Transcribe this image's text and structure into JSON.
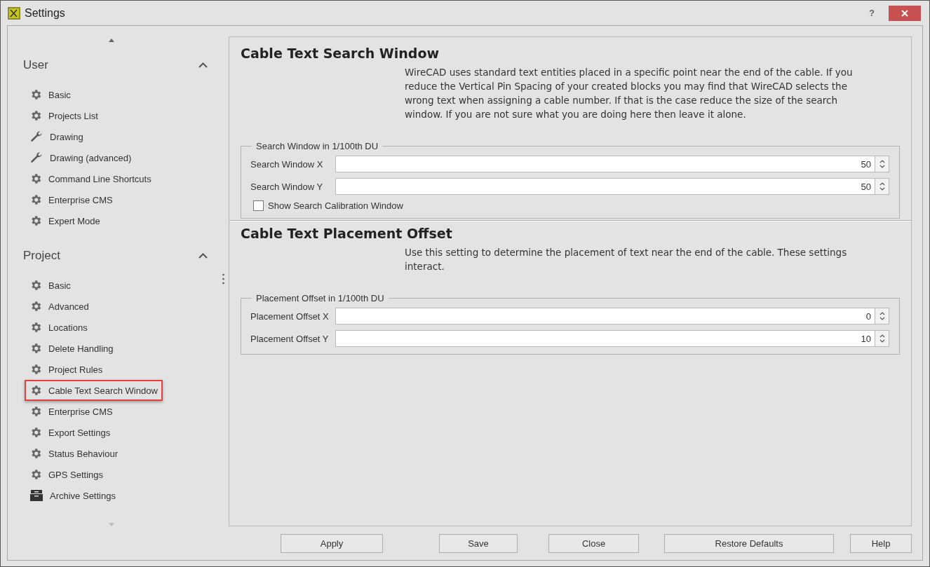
{
  "window": {
    "title": "Settings",
    "help_button": "?"
  },
  "sidebar": {
    "groups": [
      {
        "title": "User",
        "expanded": true,
        "items": [
          {
            "label": "Basic",
            "kind": "gear",
            "selected": false
          },
          {
            "label": "Projects List",
            "kind": "gear",
            "selected": false
          },
          {
            "label": "Drawing",
            "kind": "wrench",
            "selected": false
          },
          {
            "label": "Drawing (advanced)",
            "kind": "wrench",
            "selected": false
          },
          {
            "label": "Command Line Shortcuts",
            "kind": "gear",
            "selected": false
          },
          {
            "label": "Enterprise CMS",
            "kind": "gear",
            "selected": false
          },
          {
            "label": "Expert Mode",
            "kind": "gear",
            "selected": false
          }
        ]
      },
      {
        "title": "Project",
        "expanded": true,
        "items": [
          {
            "label": "Basic",
            "kind": "gear",
            "selected": false
          },
          {
            "label": "Advanced",
            "kind": "gear",
            "selected": false
          },
          {
            "label": "Locations",
            "kind": "gear",
            "selected": false
          },
          {
            "label": "Delete Handling",
            "kind": "gear",
            "selected": false
          },
          {
            "label": "Project Rules",
            "kind": "gear",
            "selected": false
          },
          {
            "label": "Cable Text Search Window",
            "kind": "gear",
            "selected": true
          },
          {
            "label": "Enterprise CMS",
            "kind": "gear",
            "selected": false
          },
          {
            "label": "Export Settings",
            "kind": "gear",
            "selected": false
          },
          {
            "label": "Status Behaviour",
            "kind": "gear",
            "selected": false
          },
          {
            "label": "GPS Settings",
            "kind": "gear",
            "selected": false
          },
          {
            "label": "Archive Settings",
            "kind": "archive",
            "selected": false
          }
        ]
      }
    ]
  },
  "sections": [
    {
      "heading": "Cable Text Search Window",
      "description": "WireCAD uses standard text entities placed in a specific point near the end of the cable. If you reduce the Vertical Pin Spacing of your created blocks you may find that WireCAD selects the wrong text when assigning a cable number. If that is the case reduce the size of the search window. If you are not sure what you are doing here then leave it alone.",
      "group_title": "Search Window in 1/100th DU",
      "fields": [
        {
          "kind": "spin",
          "label": "Search Window X",
          "value": "50"
        },
        {
          "kind": "spin",
          "label": "Search Window Y",
          "value": "50"
        },
        {
          "kind": "checkbox",
          "label": "Show Search Calibration Window",
          "checked": false
        }
      ]
    },
    {
      "heading": "Cable Text Placement Offset",
      "description": "Use this setting to determine the placement of text near the end of the cable. These settings interact.",
      "group_title": "Placement Offset in 1/100th DU",
      "fields": [
        {
          "kind": "spin",
          "label": "Placement Offset X",
          "value": "0"
        },
        {
          "kind": "spin",
          "label": "Placement Offset Y",
          "value": "10"
        }
      ]
    }
  ],
  "buttons": [
    "Apply",
    "Save",
    "Close",
    "Restore Defaults",
    "Help"
  ]
}
